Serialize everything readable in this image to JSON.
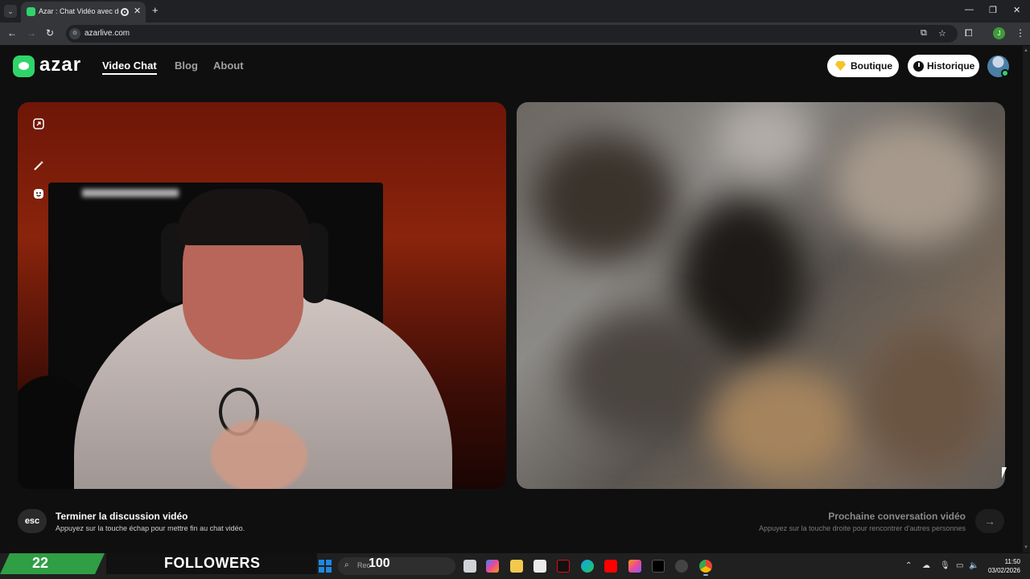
{
  "browser": {
    "tab_title": "Azar : Chat Vidéo avec de",
    "url": "azarlive.com",
    "profile_initial": "J"
  },
  "header": {
    "logo_text": "azar",
    "nav": [
      "Video Chat",
      "Blog",
      "About"
    ],
    "boutique_label": "Boutique",
    "historique_label": "Historique"
  },
  "controls": {
    "esc_key": "esc",
    "end_title": "Terminer la discussion vidéo",
    "end_sub": "Appuyez sur la touche échap pour mettre fin au chat vidéo.",
    "next_title": "Prochaine conversation vidéo",
    "next_sub": "Appuyez sur la touche droite pour rencontrer d'autres personnes"
  },
  "overlay": {
    "followers_count": "22",
    "followers_label": "FOLLOWERS",
    "number": "100"
  },
  "taskbar": {
    "search_placeholder": "Rec",
    "time": "11:50",
    "date": "03/02/2026"
  },
  "colors": {
    "brand_green": "#2fd46a",
    "gem_yellow": "#f7c325"
  }
}
